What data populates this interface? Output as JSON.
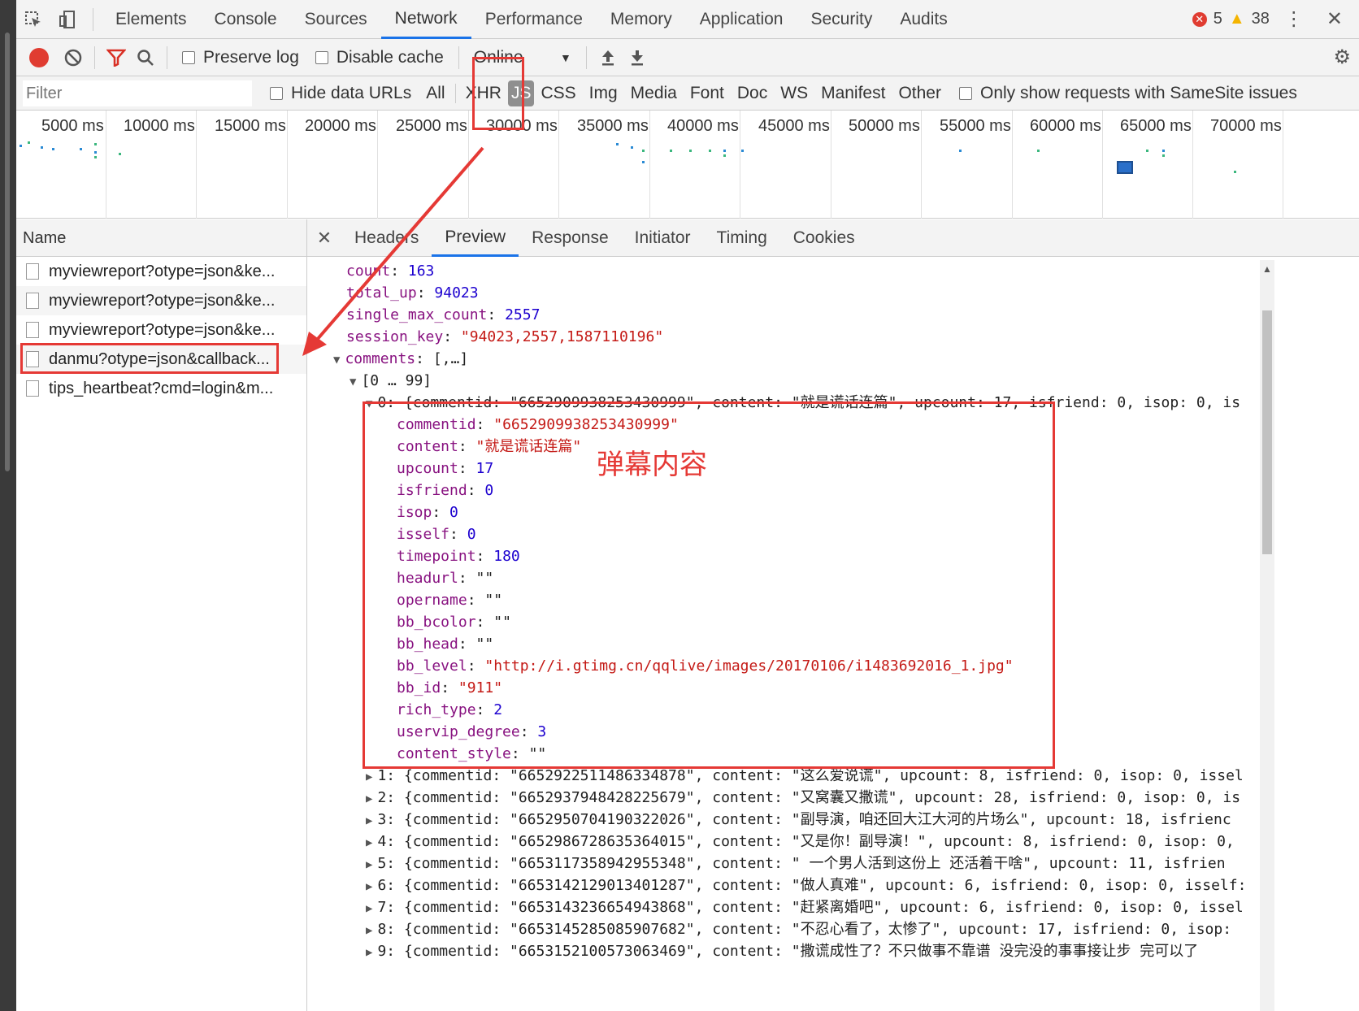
{
  "topbar": {
    "tabs": [
      "Elements",
      "Console",
      "Sources",
      "Network",
      "Performance",
      "Memory",
      "Application",
      "Security",
      "Audits"
    ],
    "active_tab": "Network",
    "error_count": "5",
    "warning_count": "38"
  },
  "toolbar": {
    "preserve_log": "Preserve log",
    "disable_cache": "Disable cache",
    "throttle_value": "Online"
  },
  "filter": {
    "placeholder": "Filter",
    "hide_data_urls": "Hide data URLs",
    "types": [
      "All",
      "XHR",
      "JS",
      "CSS",
      "Img",
      "Media",
      "Font",
      "Doc",
      "WS",
      "Manifest",
      "Other"
    ],
    "selected_type": "JS",
    "samesite": "Only show requests with SameSite issues"
  },
  "overview": {
    "ticks": [
      "5000 ms",
      "10000 ms",
      "15000 ms",
      "20000 ms",
      "25000 ms",
      "30000 ms",
      "35000 ms",
      "40000 ms",
      "45000 ms",
      "50000 ms",
      "55000 ms",
      "60000 ms",
      "65000 ms",
      "70000 ms"
    ]
  },
  "name_panel": {
    "header": "Name",
    "requests": [
      "myviewreport?otype=json&ke...",
      "myviewreport?otype=json&ke...",
      "myviewreport?otype=json&ke...",
      "danmu?otype=json&callback...",
      "tips_heartbeat?cmd=login&m..."
    ]
  },
  "detail": {
    "tabs": [
      "Headers",
      "Preview",
      "Response",
      "Initiator",
      "Timing",
      "Cookies"
    ],
    "active_tab": "Preview",
    "lines": {
      "count": {
        "key": "count",
        "val": "163"
      },
      "total_up": {
        "key": "total_up",
        "val": "94023"
      },
      "single_max": {
        "key": "single_max_count",
        "val": "2557"
      },
      "session_key": {
        "key": "session_key",
        "val": "\"94023,2557,1587110196\""
      },
      "comments": {
        "key": "comments",
        "val": "[,…]"
      },
      "range": "[0 … 99]",
      "item0_summary": "0: {commentid: \"6652909938253430999\", content: \"就是谎话连篇\", upcount: 17, isfriend: 0, isop: 0, is",
      "fields": [
        {
          "key": "commentid",
          "val": "\"6652909938253430999\"",
          "type": "s"
        },
        {
          "key": "content",
          "val": "\"就是谎话连篇\"",
          "type": "s"
        },
        {
          "key": "upcount",
          "val": "17",
          "type": "n"
        },
        {
          "key": "isfriend",
          "val": "0",
          "type": "n"
        },
        {
          "key": "isop",
          "val": "0",
          "type": "n"
        },
        {
          "key": "isself",
          "val": "0",
          "type": "n"
        },
        {
          "key": "timepoint",
          "val": "180",
          "type": "n"
        },
        {
          "key": "headurl",
          "val": "\"\"",
          "type": "p"
        },
        {
          "key": "opername",
          "val": "\"\"",
          "type": "p"
        },
        {
          "key": "bb_bcolor",
          "val": "\"\"",
          "type": "p"
        },
        {
          "key": "bb_head",
          "val": "\"\"",
          "type": "p"
        },
        {
          "key": "bb_level",
          "val": "\"http://i.gtimg.cn/qqlive/images/20170106/i1483692016_1.jpg\"",
          "type": "s"
        },
        {
          "key": "bb_id",
          "val": "\"911\"",
          "type": "s"
        },
        {
          "key": "rich_type",
          "val": "2",
          "type": "n"
        },
        {
          "key": "uservip_degree",
          "val": "3",
          "type": "n"
        },
        {
          "key": "content_style",
          "val": "\"\"",
          "type": "p"
        }
      ],
      "items": [
        "1: {commentid: \"6652922511486334878\", content: \"这么爱说谎\", upcount: 8, isfriend: 0, isop: 0, issel",
        "2: {commentid: \"6652937948428225679\", content: \"又窝囊又撒谎\", upcount: 28, isfriend: 0, isop: 0, is",
        "3: {commentid: \"6652950704190322026\", content: \"副导演，咱还回大江大河的片场么\", upcount: 18, isfrienc",
        "4: {commentid: \"6652986728635364015\", content: \"又是你！副导演！\", upcount: 8, isfriend: 0, isop: 0,",
        "5: {commentid: \"6653117358942955348\", content: \" 一个男人活到这份上  还活着干啥\", upcount: 11, isfrien",
        "6: {commentid: \"6653142129013401287\", content: \"做人真难\", upcount: 6, isfriend: 0, isop: 0, isself:",
        "7: {commentid: \"6653143236654943868\", content: \"赶紧离婚吧\", upcount: 6, isfriend: 0, isop: 0, issel",
        "8: {commentid: \"6653145285085907682\", content: \"不忍心看了，太惨了\", upcount: 17, isfriend: 0, isop:",
        "9: {commentid: \"6653152100573063469\", content: \"撒谎成性了？不只做事不靠谱  没完没的事事接让步   完可以了"
      ]
    }
  },
  "annotation": {
    "label": "弹幕内容",
    "color": "#e53935"
  }
}
